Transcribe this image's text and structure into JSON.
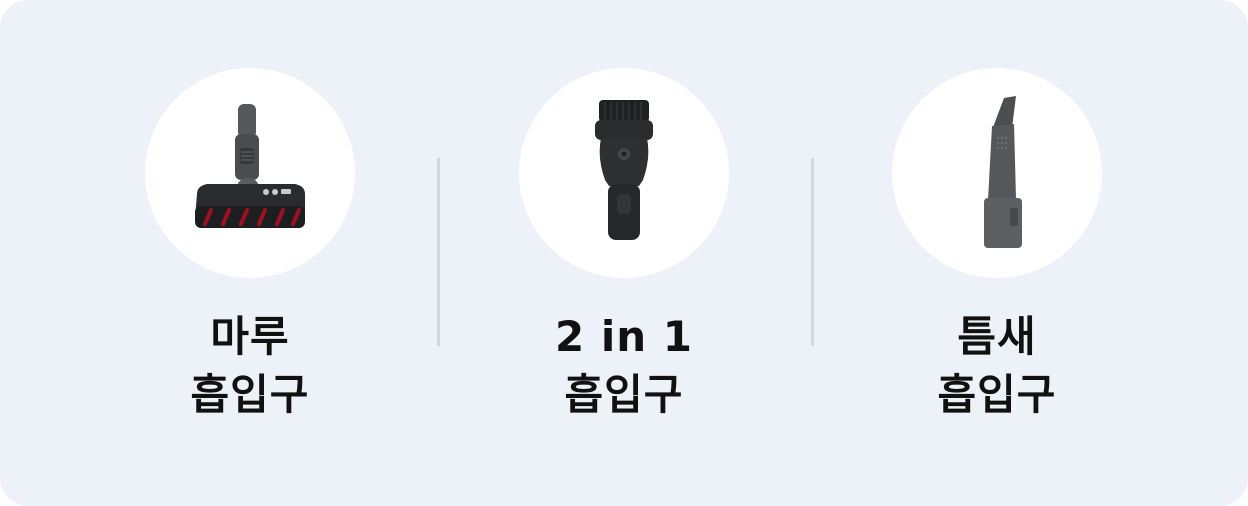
{
  "items": [
    {
      "icon": "floor-nozzle-icon",
      "line1": "마루",
      "line2": "흡입구"
    },
    {
      "icon": "2in1-nozzle-icon",
      "line1": "2 in 1",
      "line2": "흡입구"
    },
    {
      "icon": "crevice-nozzle-icon",
      "line1": "틈새",
      "line2": "흡입구"
    }
  ],
  "colors": {
    "panel_background": "#edf1f8",
    "circle_background": "#ffffff",
    "divider": "#d3d6dc",
    "text": "#111111",
    "accent_red": "#a01020"
  }
}
